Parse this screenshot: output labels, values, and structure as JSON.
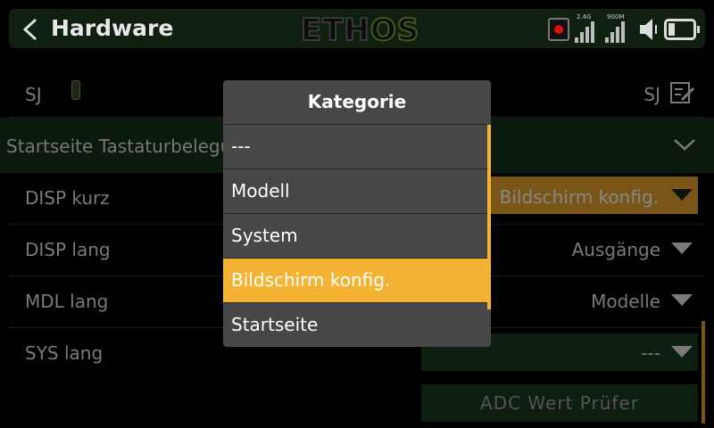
{
  "header": {
    "title": "Hardware",
    "logo_main": "ETH",
    "logo_os": "OS",
    "signal1_label": "2.4G",
    "signal2_label": "900M"
  },
  "rows": {
    "sj_label": "SJ",
    "sj_value": "SJ",
    "section_label": "Startseite Tastaturbelegung",
    "disp_kurz_label": "DISP kurz",
    "disp_kurz_value": "Bildschirm konfig.",
    "disp_lang_label": "DISP lang",
    "disp_lang_value": "Ausgänge",
    "mdl_lang_label": "MDL lang",
    "mdl_lang_value": "Modelle",
    "sys_lang_label": "SYS lang",
    "sys_lang_value": "---",
    "adc_button": "ADC Wert Prüfer"
  },
  "dialog": {
    "title": "Kategorie",
    "options": [
      "---",
      "Modell",
      "System",
      "Bildschirm konfig.",
      "Startseite"
    ],
    "selected_index": 3
  },
  "colors": {
    "accent": "#f5b334",
    "dialog_bg": "#474747"
  }
}
